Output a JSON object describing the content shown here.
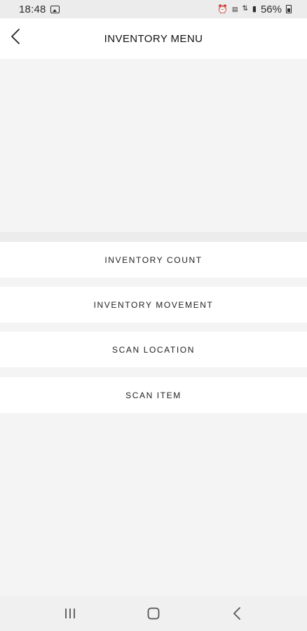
{
  "status_bar": {
    "time": "18:48",
    "battery_percent": "56%",
    "icons": [
      "gallery-icon",
      "alarm-icon",
      "volte-icon",
      "data-icon",
      "signal-icon",
      "battery-icon"
    ]
  },
  "header": {
    "title": "INVENTORY MENU",
    "back_icon": "chevron-left-icon"
  },
  "menu": {
    "items": [
      {
        "label": "INVENTORY COUNT"
      },
      {
        "label": "INVENTORY MOVEMENT"
      },
      {
        "label": "SCAN LOCATION"
      },
      {
        "label": "SCAN ITEM"
      }
    ]
  },
  "nav_bar": {
    "icons": [
      "recent-apps-icon",
      "home-icon",
      "back-icon"
    ]
  },
  "colors": {
    "background": "#f4f4f4",
    "card": "#ffffff",
    "text": "#1f1f1f"
  }
}
